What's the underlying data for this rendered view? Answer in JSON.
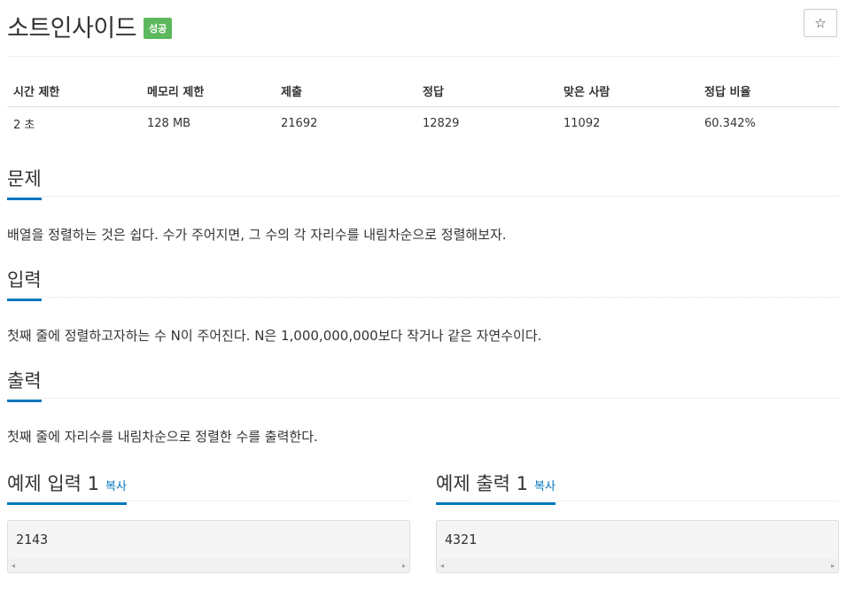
{
  "problem": {
    "title": "소트인사이드",
    "badge": "성공"
  },
  "star": {
    "icon": "☆"
  },
  "info_table": {
    "headers": [
      "시간 제한",
      "메모리 제한",
      "제출",
      "정답",
      "맞은 사람",
      "정답 비율"
    ],
    "values": [
      "2 초",
      "128 MB",
      "21692",
      "12829",
      "11092",
      "60.342%"
    ]
  },
  "sections": {
    "problem": {
      "title": "문제",
      "text": "배열을 정렬하는 것은 쉽다. 수가 주어지면, 그 수의 각 자리수를 내림차순으로 정렬해보자."
    },
    "input": {
      "title": "입력",
      "text": "첫째 줄에 정렬하고자하는 수 N이 주어진다. N은 1,000,000,000보다 작거나 같은 자연수이다."
    },
    "output": {
      "title": "출력",
      "text": "첫째 줄에 자리수를 내림차순으로 정렬한 수를 출력한다."
    }
  },
  "examples": {
    "input": {
      "title": "예제 입력 1",
      "copy": "복사",
      "value": "2143"
    },
    "output": {
      "title": "예제 출력 1",
      "copy": "복사",
      "value": "4321"
    }
  },
  "scroll_arrows": {
    "left": "◂",
    "right": "▸"
  },
  "colors": {
    "accent": "#0076c0",
    "badge": "#5cb85c"
  }
}
